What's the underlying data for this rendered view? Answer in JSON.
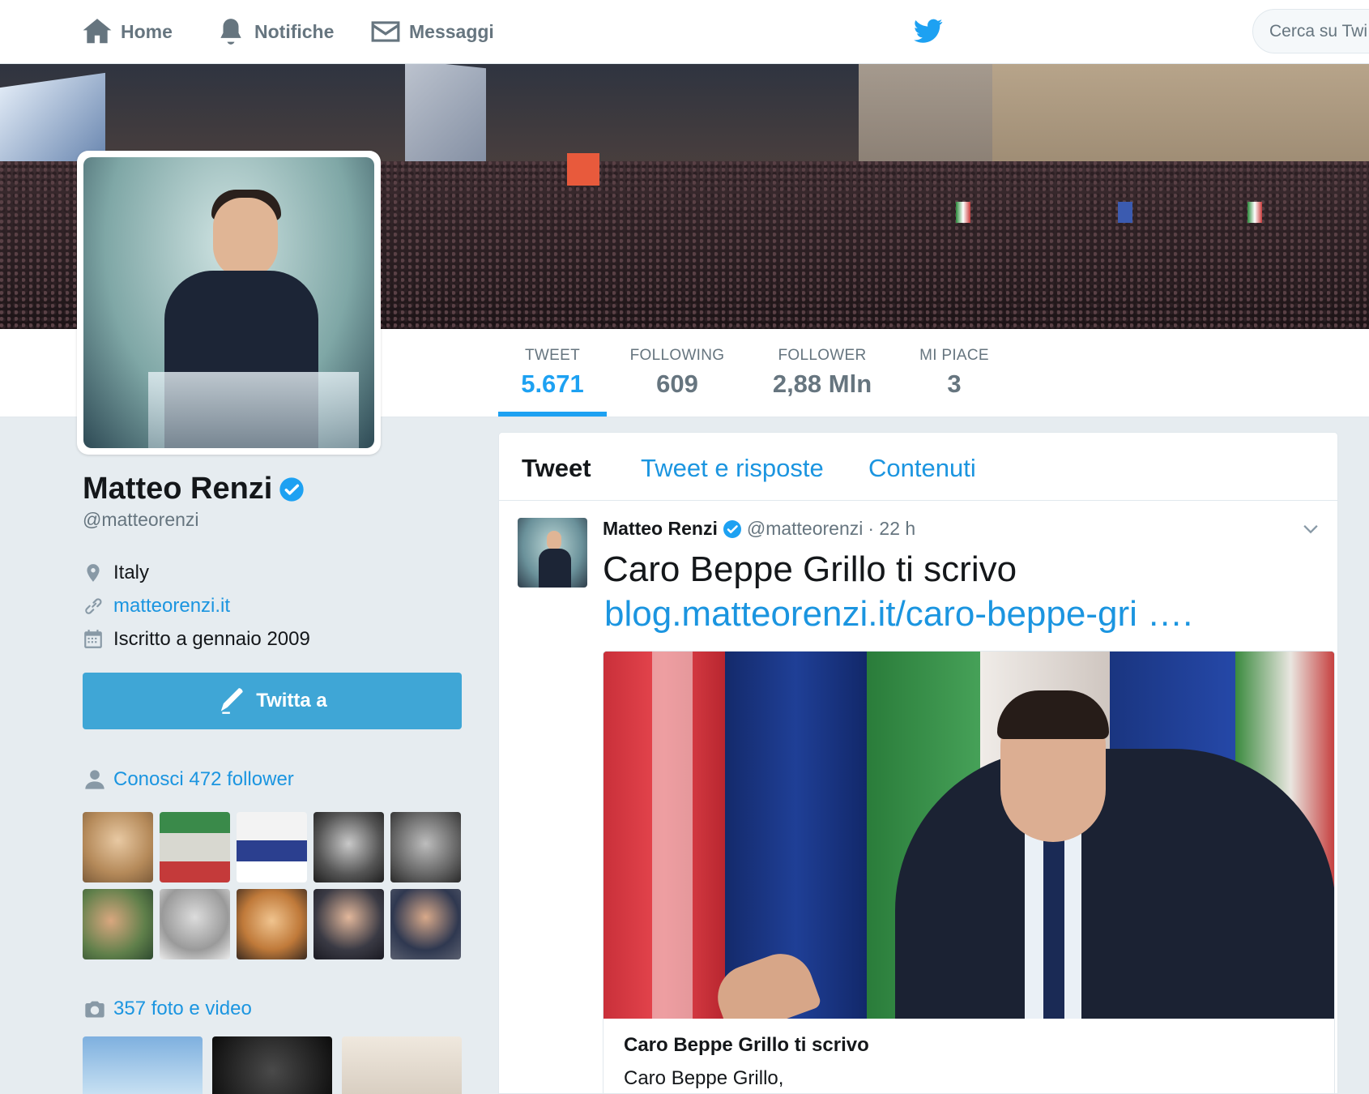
{
  "nav": {
    "home": "Home",
    "notifications": "Notifiche",
    "messages": "Messaggi",
    "search_placeholder": "Cerca su Twi"
  },
  "stats": {
    "tweet_label": "TWEET",
    "tweet_value": "5.671",
    "following_label": "FOLLOWING",
    "following_value": "609",
    "follower_label": "FOLLOWER",
    "follower_value": "2,88 Mln",
    "likes_label": "MI PIACE",
    "likes_value": "3"
  },
  "profile": {
    "name": "Matteo Renzi",
    "handle": "@matteorenzi",
    "location": "Italy",
    "url": "matteorenzi.it",
    "joined": "Iscritto a gennaio 2009",
    "tweet_to_label": "Twitta a",
    "followers_you_know": "Conosci 472 follower",
    "photos_videos": "357 foto e video"
  },
  "tabs": {
    "tweets": "Tweet",
    "replies": "Tweet e risposte",
    "media": "Contenuti"
  },
  "tweet": {
    "author": "Matteo Renzi",
    "handle": "@matteorenzi",
    "time": "· 22 h",
    "text": "Caro Beppe Grillo ti scrivo",
    "link": "blog.matteorenzi.it/caro-beppe-gri  ….",
    "card_title": "Caro Beppe Grillo ti scrivo",
    "card_desc": "Caro Beppe Grillo,"
  },
  "colors": {
    "brand": "#1da1f2",
    "link": "#1b95e0",
    "button": "#3fa6d6",
    "background": "#e6ecf0"
  }
}
